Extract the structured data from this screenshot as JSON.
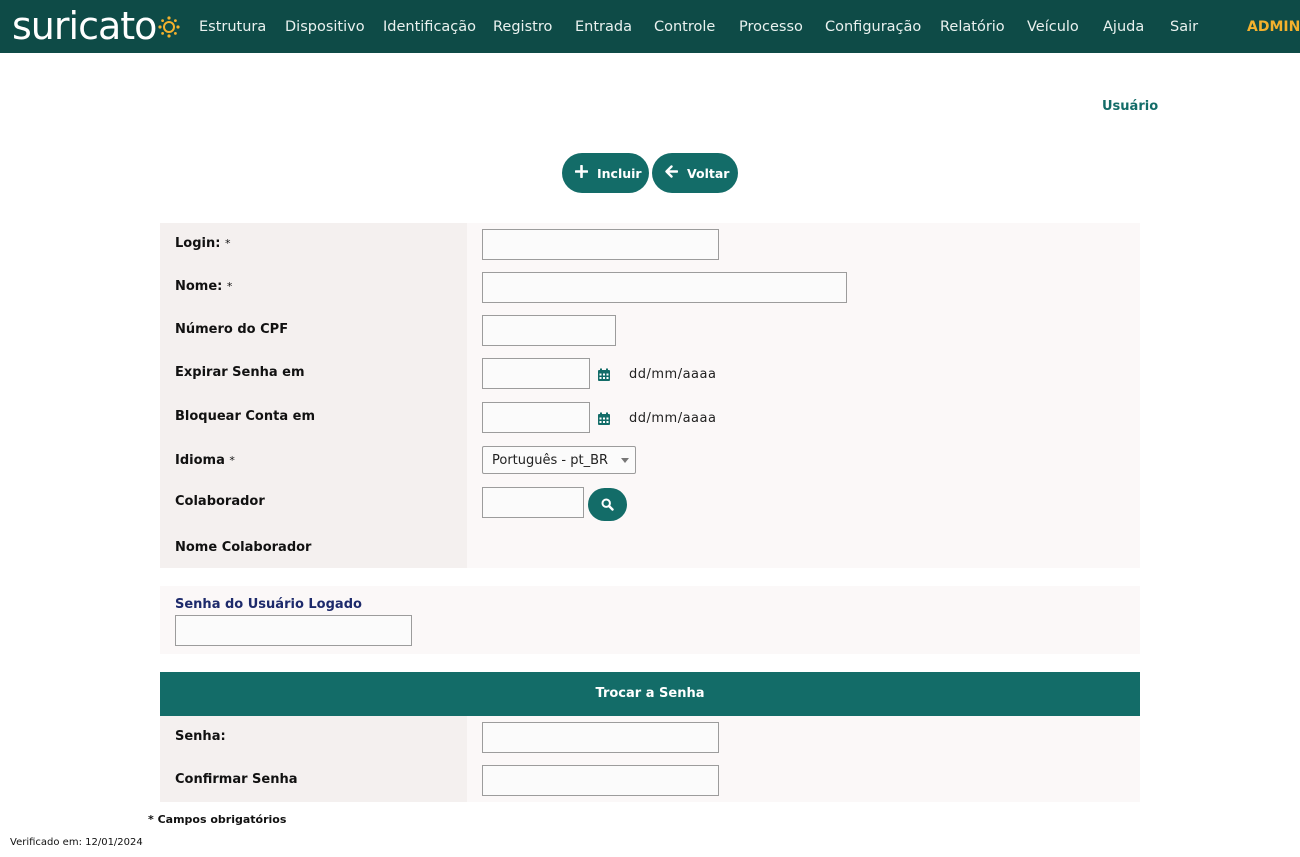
{
  "header": {
    "logo_text": "suricato",
    "nav": [
      "Estrutura",
      "Dispositivo",
      "Identificação",
      "Registro",
      "Entrada",
      "Controle",
      "Processo",
      "Configuração",
      "Relatório",
      "Veículo",
      "Ajuda",
      "Sair"
    ],
    "user_label": "ADMIN"
  },
  "page": {
    "title": "Usuário"
  },
  "actions": {
    "add_label": "Incluir",
    "back_label": "Voltar"
  },
  "form": {
    "login_label": "Login:",
    "nome_label": "Nome:",
    "cpf_label": "Número do CPF",
    "expirar_label": "Expirar Senha em",
    "bloquear_label": "Bloquear Conta em",
    "idioma_label": "Idioma",
    "colaborador_label": "Colaborador",
    "nome_colaborador_label": "Nome Colaborador",
    "required_mark": "*",
    "date_format": "dd/mm/aaaa",
    "idioma_value": "Português - pt_BR",
    "login_value": "",
    "nome_value": "",
    "cpf_value": "",
    "expirar_value": "",
    "bloquear_value": "",
    "colaborador_value": ""
  },
  "logged_password": {
    "label": "Senha do Usuário Logado",
    "value": ""
  },
  "change_password": {
    "title": "Trocar a Senha",
    "senha_label": "Senha:",
    "confirmar_label": "Confirmar Senha"
  },
  "footer": {
    "required_note": "* Campos obrigatórios",
    "verified": "Verificado em: 12/01/2024"
  },
  "colors": {
    "header": "#0e4b47",
    "accent": "#136c68",
    "admin": "#f4b12d",
    "logo_dot": "#f4b12d"
  }
}
